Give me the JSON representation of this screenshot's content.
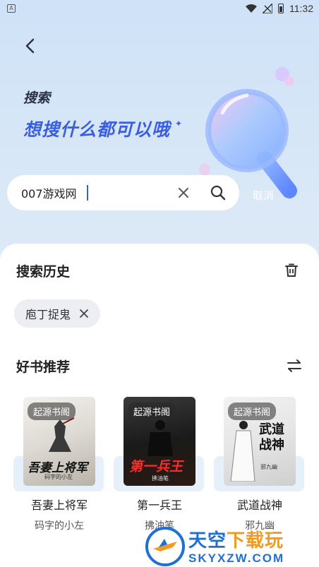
{
  "status_bar": {
    "time": "11:32",
    "app_indicator": "A"
  },
  "hero": {
    "title": "搜索",
    "subtitle": "想搜什么都可以哦"
  },
  "search": {
    "value": "007游戏网",
    "cancel_label": "取消"
  },
  "history": {
    "title": "搜索历史",
    "items": [
      {
        "label": "庖丁捉鬼"
      }
    ]
  },
  "recommend": {
    "title": "好书推荐",
    "books": [
      {
        "badge": "起源书阁",
        "name": "吾妻上将军",
        "author": "码字的小左",
        "cover_title": "吾妻上将军",
        "cover_author": "码字的小左"
      },
      {
        "badge": "起源书阁",
        "name": "第一兵王",
        "author": "拂油笔",
        "cover_title": "第一兵王",
        "cover_author": "拂油笔"
      },
      {
        "badge": "起源书阁",
        "name": "武道战神",
        "author": "邪九幽",
        "cover_title": "武道战神",
        "cover_author": "邪九幽"
      }
    ]
  },
  "watermark": {
    "brand_a": "天空",
    "brand_b": "下载玩",
    "url": "SKYXZW.COM"
  },
  "colors": {
    "accent": "#3a5ee0",
    "panel": "#ffffff",
    "tag_bg": "#eceef3",
    "book_bg": "#e6f0fb"
  },
  "icons": [
    "back-arrow-icon",
    "clear-icon",
    "search-icon",
    "trash-icon",
    "close-icon",
    "swap-icon",
    "wifi-icon",
    "signal-icon",
    "battery-icon"
  ]
}
